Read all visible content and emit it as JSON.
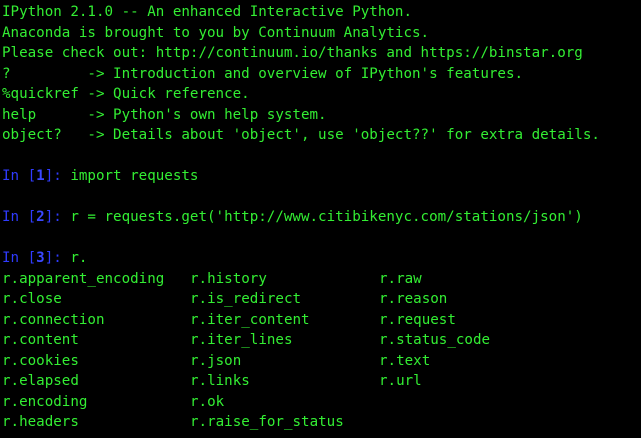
{
  "banner": [
    "IPython 2.1.0 -- An enhanced Interactive Python.",
    "Anaconda is brought to you by Continuum Analytics.",
    "Please check out: http://continuum.io/thanks and https://binstar.org",
    "?         -> Introduction and overview of IPython's features.",
    "%quickref -> Quick reference.",
    "help      -> Python's own help system.",
    "object?   -> Details about 'object', use 'object??' for extra details."
  ],
  "prompts": [
    {
      "prefix": "In [",
      "number": "1",
      "suffix": "]: ",
      "command": "import requests"
    },
    {
      "prefix": "In [",
      "number": "2",
      "suffix": "]: ",
      "command": "r = requests.get('http://www.citibikenyc.com/stations/json')"
    },
    {
      "prefix": "In [",
      "number": "3",
      "suffix": "]: ",
      "command": "r."
    }
  ],
  "completions": {
    "col1": [
      "r.apparent_encoding",
      "r.close",
      "r.connection",
      "r.content",
      "r.cookies",
      "r.elapsed",
      "r.encoding",
      "r.headers"
    ],
    "col2": [
      "r.history",
      "r.is_redirect",
      "r.iter_content",
      "r.iter_lines",
      "r.json",
      "r.links",
      "r.ok",
      "r.raise_for_status"
    ],
    "col3": [
      "r.raw",
      "r.reason",
      "r.request",
      "r.status_code",
      "r.text",
      "r.url",
      "",
      ""
    ]
  },
  "colors": {
    "background": "#000000",
    "text": "#33ee33",
    "prompt": "#2f3bff"
  }
}
